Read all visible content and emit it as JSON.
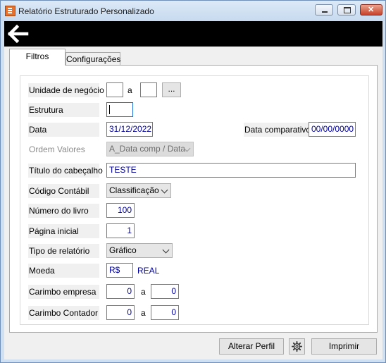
{
  "window": {
    "title": "Relatório Estruturado Personalizado"
  },
  "tabs": [
    {
      "label": "Filtros"
    },
    {
      "label": "Configurações"
    }
  ],
  "form": {
    "unidade": {
      "label": "Unidade de negócio",
      "from": "",
      "sep": "a",
      "to": "",
      "browse": "..."
    },
    "estrutura": {
      "label": "Estrutura",
      "value": ""
    },
    "data": {
      "label": "Data",
      "value": "31/12/2022"
    },
    "data_comparativo": {
      "label": "Data comparativo",
      "value": "00/00/0000"
    },
    "ordem": {
      "label": "Ordem Valores",
      "value": "A_Data comp / Data"
    },
    "titulo": {
      "label": "Título do cabeçalho",
      "value": "TESTE"
    },
    "codigo": {
      "label": "Código Contábil",
      "value": "Classificação"
    },
    "numero_livro": {
      "label": "Número do livro",
      "value": "100"
    },
    "pagina": {
      "label": "Página inicial",
      "value": "1"
    },
    "tipo": {
      "label": "Tipo de relatório",
      "value": "Gráfico"
    },
    "moeda": {
      "label": "Moeda",
      "value": "R$",
      "desc": "REAL"
    },
    "carimbo_empresa": {
      "label": "Carimbo empresa",
      "from": "0",
      "sep": "a",
      "to": "0"
    },
    "carimbo_contador": {
      "label": "Carimbo Contador",
      "from": "0",
      "sep": "a",
      "to": "0"
    }
  },
  "buttons": {
    "alterar_perfil": "Alterar Perfil",
    "imprimir": "Imprimir"
  },
  "icons": {
    "back": "arrow-left-icon",
    "settings": "gear-icon"
  }
}
